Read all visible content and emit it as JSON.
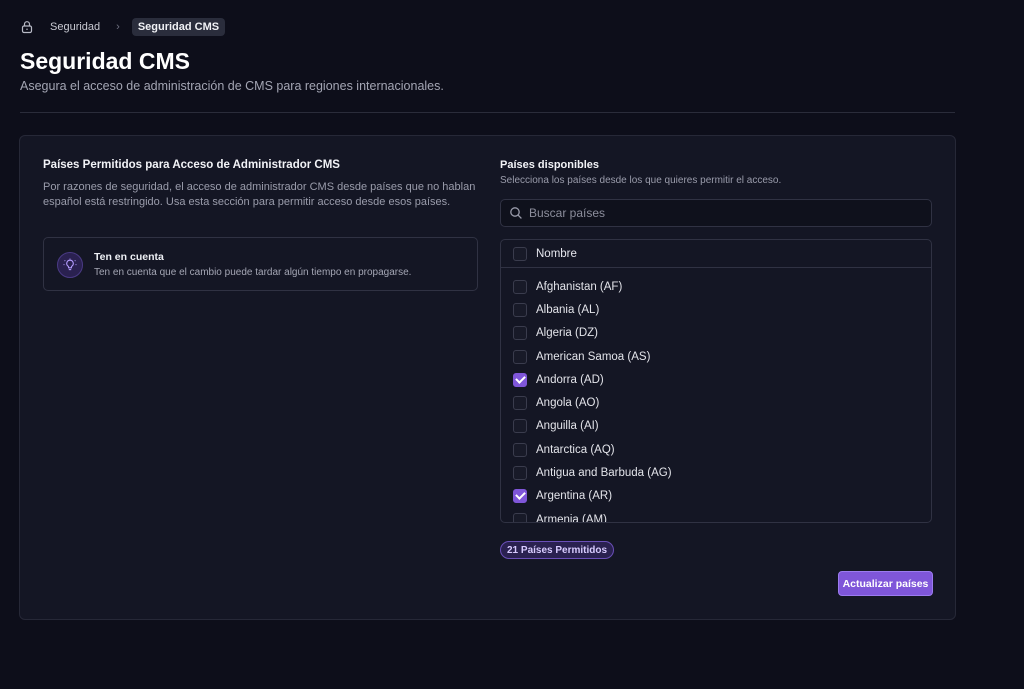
{
  "breadcrumb": {
    "icon": "lock-icon",
    "parent": "Seguridad",
    "current": "Seguridad CMS"
  },
  "header": {
    "title": "Seguridad CMS",
    "subtitle": "Asegura el acceso de administración de CMS para regiones internacionales."
  },
  "left": {
    "title": "Países Permitidos para Acceso de Administrador CMS",
    "description": "Por razones de seguridad, el acceso de administrador CMS desde países que no hablan español está restringido. Usa esta sección para permitir acceso desde esos países.",
    "notice": {
      "icon": "lightbulb-icon",
      "title": "Ten en cuenta",
      "text": "Ten en cuenta que el cambio puede tardar algún tiempo en propagarse."
    }
  },
  "right": {
    "title": "Países disponibles",
    "subtitle": "Selecciona los países desde los que quieres permitir el acceso.",
    "search_placeholder": "Buscar países",
    "column_header": "Nombre",
    "countries": [
      {
        "label": "Afghanistan (AF)",
        "checked": false
      },
      {
        "label": "Albania (AL)",
        "checked": false
      },
      {
        "label": "Algeria (DZ)",
        "checked": false
      },
      {
        "label": "American Samoa (AS)",
        "checked": false
      },
      {
        "label": "Andorra (AD)",
        "checked": true
      },
      {
        "label": "Angola (AO)",
        "checked": false
      },
      {
        "label": "Anguilla (AI)",
        "checked": false
      },
      {
        "label": "Antarctica (AQ)",
        "checked": false
      },
      {
        "label": "Antigua and Barbuda (AG)",
        "checked": false
      },
      {
        "label": "Argentina (AR)",
        "checked": true
      },
      {
        "label": "Armenia (AM)",
        "checked": false
      }
    ],
    "badge": "21 Países Permitidos",
    "update_button": "Actualizar países"
  },
  "colors": {
    "background": "#0d0e1a",
    "card": "#141624",
    "accent": "#7f56d9"
  }
}
